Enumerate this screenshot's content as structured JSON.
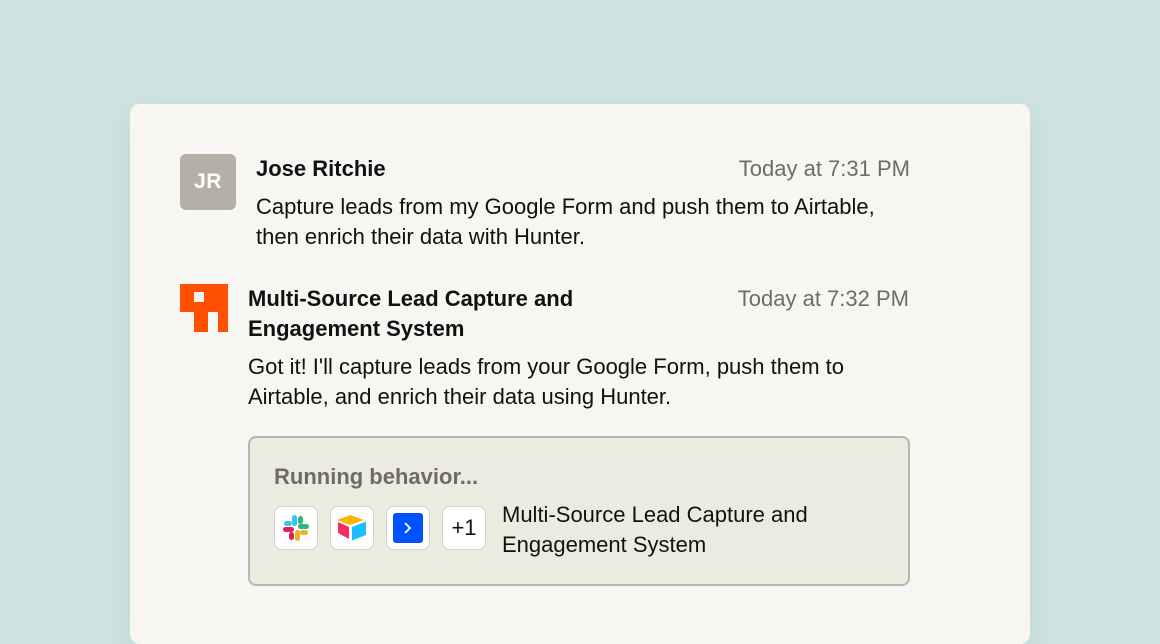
{
  "messages": [
    {
      "avatar_initials": "JR",
      "author": "Jose Ritchie",
      "time": "Today at 7:31 PM",
      "text": "Capture leads from my Google Form and push them to Airtable, then enrich their data with Hunter."
    },
    {
      "avatar_icon": "brand-logo-icon",
      "author": "Multi-Source Lead Capture and Engagement System",
      "time": "Today at 7:32 PM",
      "text": "Got it! I'll capture leads from your Google Form, push them to Airtable, and enrich their data using Hunter."
    }
  ],
  "running": {
    "title": "Running behavior...",
    "apps": [
      "slack-icon",
      "airtable-icon",
      "terminal-icon"
    ],
    "extra_count": "+1",
    "label": "Multi-Source Lead Capture and Engagement System"
  },
  "colors": {
    "background": "#cfe4e0",
    "card": "#f7f6f2",
    "brand": "#ff4f00",
    "avatar": "#b4b0a6",
    "run_box": "#ecebe0"
  }
}
